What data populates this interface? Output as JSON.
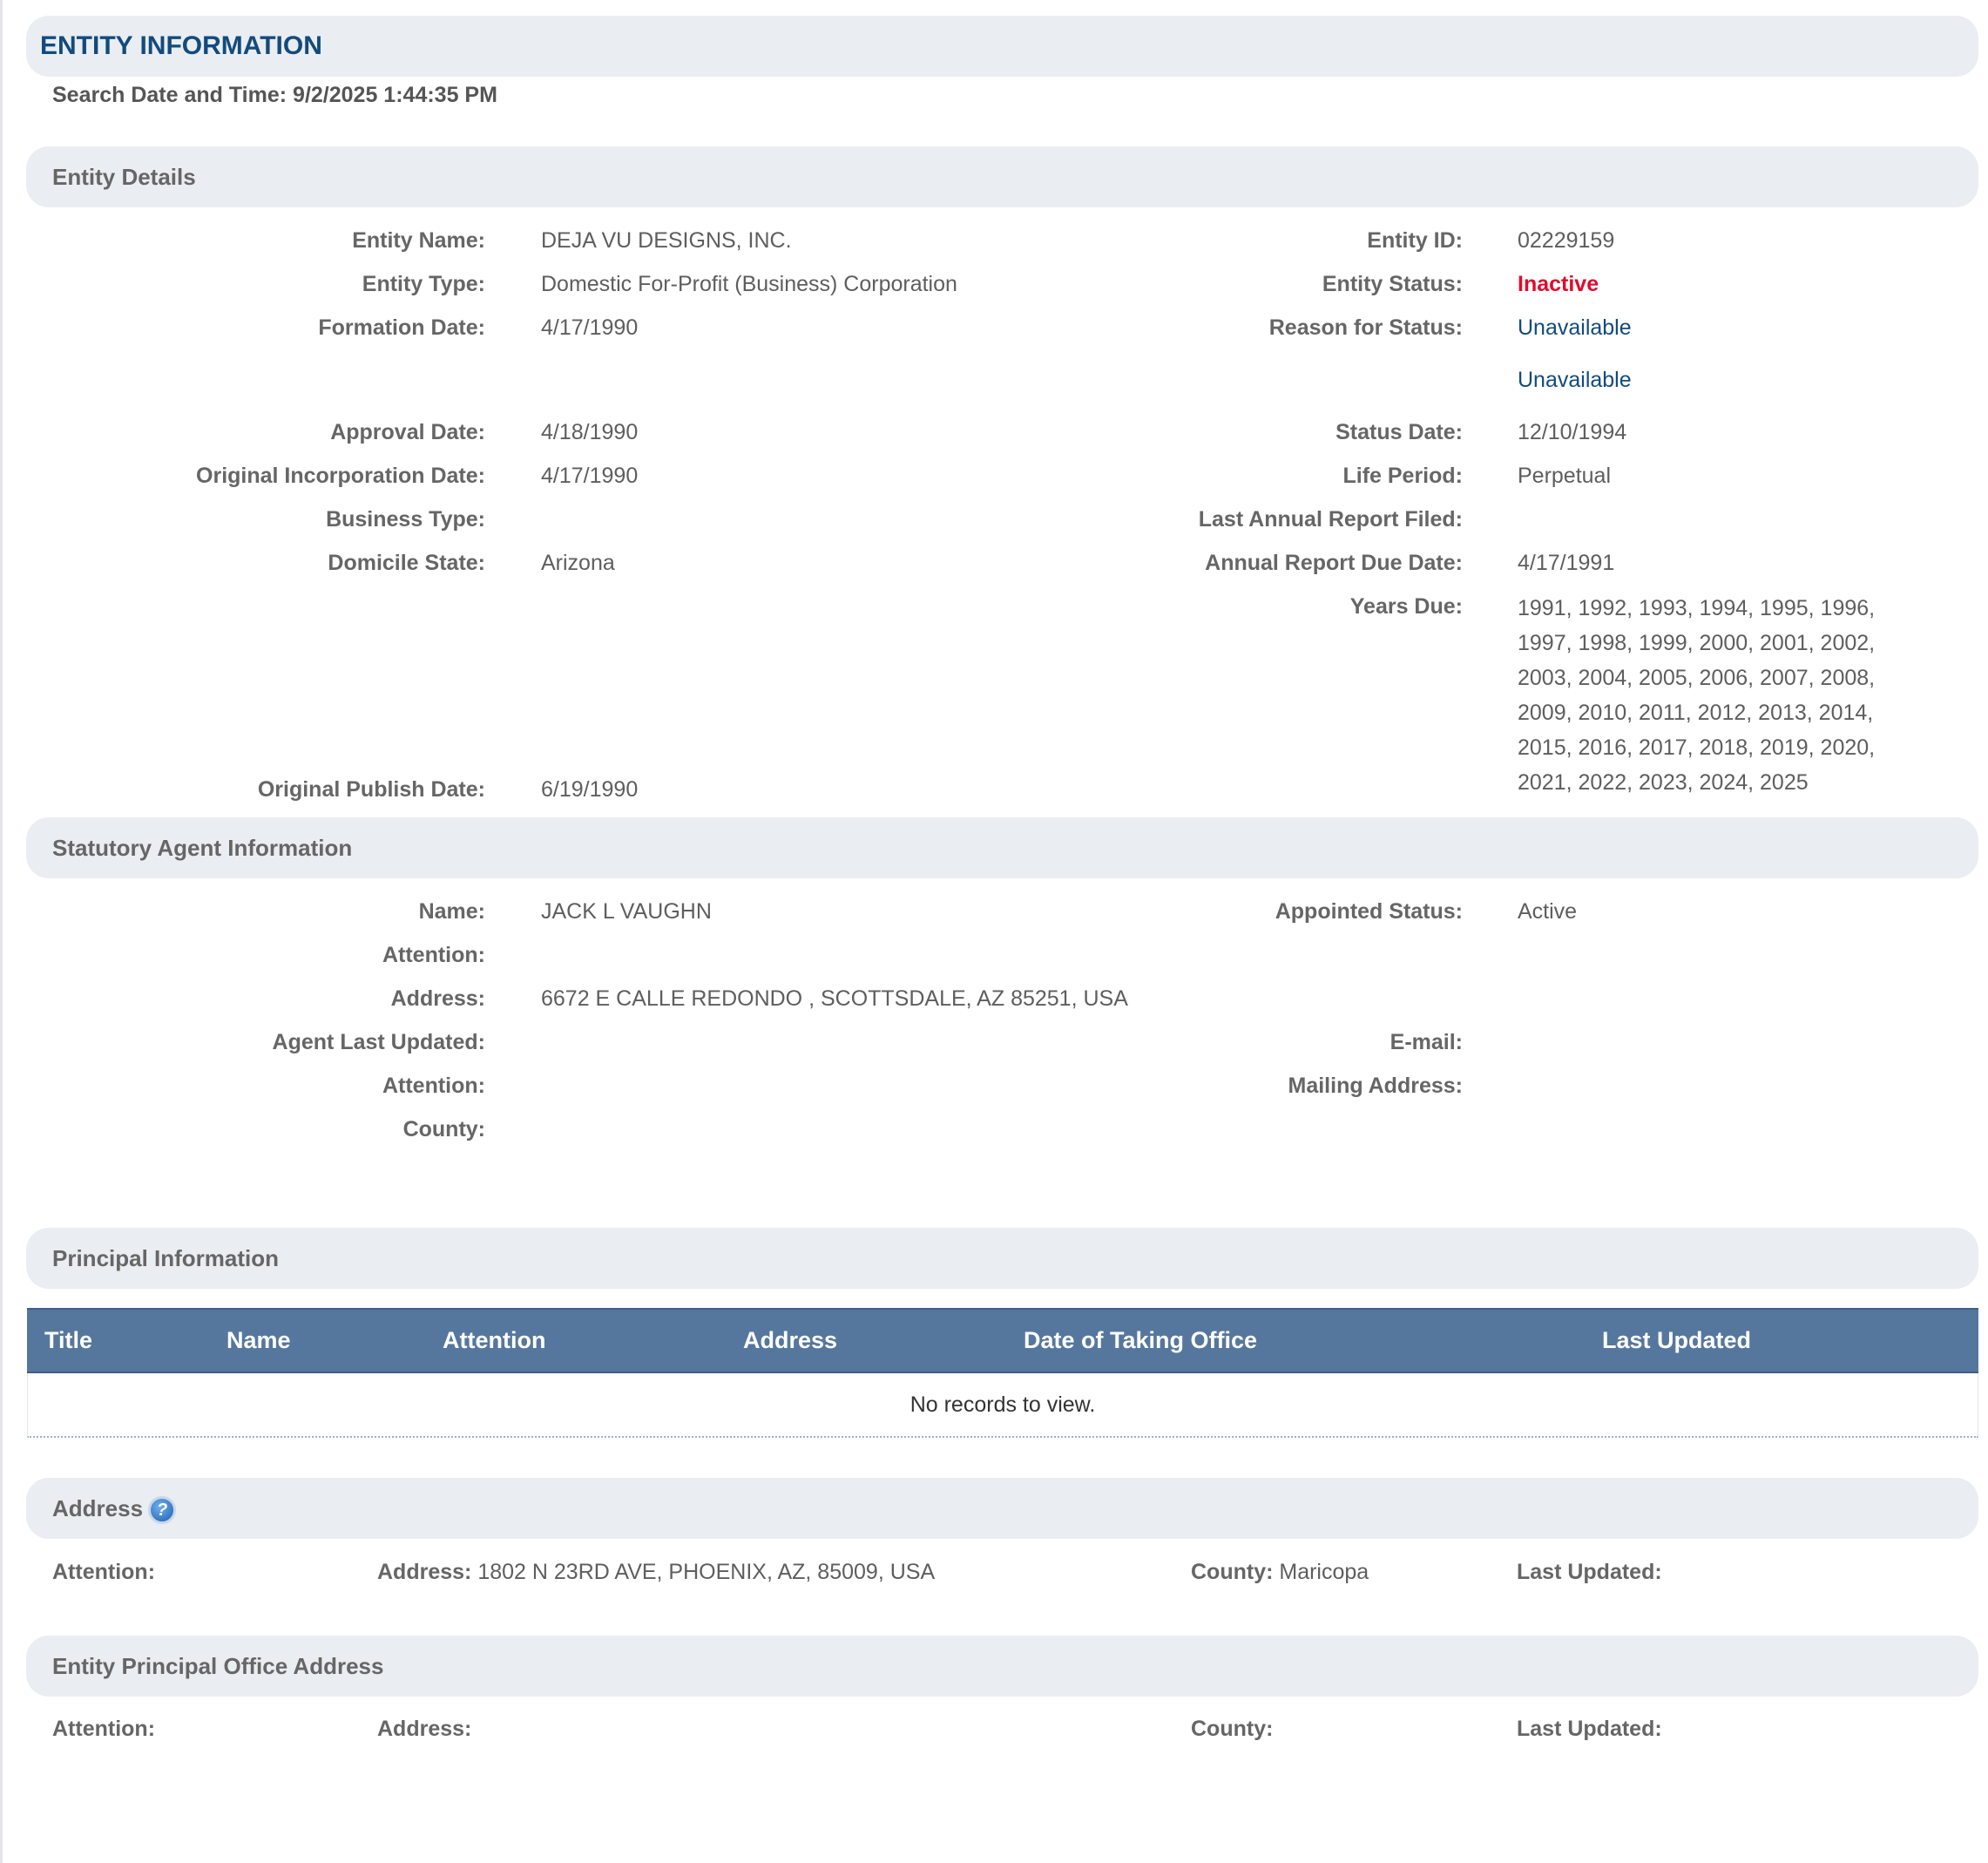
{
  "header": {
    "title": "ENTITY INFORMATION",
    "search_label": "Search Date and Time:",
    "search_value": "9/2/2025 1:44:35 PM"
  },
  "entity_details": {
    "section_title": "Entity Details",
    "entity_name_label": "Entity Name:",
    "entity_name": "DEJA VU DESIGNS, INC.",
    "entity_id_label": "Entity ID:",
    "entity_id": "02229159",
    "entity_type_label": "Entity Type:",
    "entity_type": "Domestic For-Profit (Business) Corporation",
    "entity_status_label": "Entity Status:",
    "entity_status": "Inactive",
    "formation_date_label": "Formation Date:",
    "formation_date": "4/17/1990",
    "reason_label": "Reason for Status:",
    "reason_1": "Unavailable",
    "reason_2": "Unavailable",
    "approval_date_label": "Approval Date:",
    "approval_date": "4/18/1990",
    "status_date_label": "Status Date:",
    "status_date": "12/10/1994",
    "orig_incorp_label": "Original Incorporation Date:",
    "orig_incorp_date": "4/17/1990",
    "life_period_label": "Life Period:",
    "life_period": "Perpetual",
    "business_type_label": "Business Type:",
    "business_type": "",
    "last_annual_label": "Last Annual Report Filed:",
    "last_annual": "",
    "domicile_label": "Domicile State:",
    "domicile_state": "Arizona",
    "annual_due_label": "Annual Report Due Date:",
    "annual_due_date": "4/17/1991",
    "years_due_label": "Years Due:",
    "years_due": "1991, 1992, 1993, 1994, 1995, 1996, 1997, 1998, 1999, 2000, 2001, 2002, 2003, 2004, 2005, 2006, 2007, 2008, 2009, 2010, 2011, 2012, 2013, 2014, 2015, 2016, 2017, 2018, 2019, 2020, 2021, 2022, 2023, 2024, 2025",
    "orig_publish_label": "Original Publish Date:",
    "orig_publish_date": "6/19/1990"
  },
  "agent": {
    "section_title": "Statutory Agent Information",
    "name_label": "Name:",
    "name": "JACK L VAUGHN",
    "appointed_label": "Appointed Status:",
    "appointed_status": "Active",
    "attention_label": "Attention:",
    "address_label": "Address:",
    "address": "6672 E CALLE REDONDO , SCOTTSDALE, AZ 85251, USA",
    "last_updated_label": "Agent Last Updated:",
    "email_label": "E-mail:",
    "attention2_label": "Attention:",
    "mailing_label": "Mailing Address:",
    "county_label": "County:"
  },
  "principal": {
    "section_title": "Principal Information",
    "columns": [
      "Title",
      "Name",
      "Attention",
      "Address",
      "Date of Taking Office",
      "Last Updated"
    ],
    "empty_message": "No records to view."
  },
  "address": {
    "section_title": "Address",
    "help_glyph": "?",
    "attention_label": "Attention:",
    "address_label": "Address:",
    "address_value": "1802 N 23RD AVE, PHOENIX, AZ, 85009, USA",
    "county_label": "County:",
    "county_value": "Maricopa",
    "last_updated_label": "Last Updated:"
  },
  "principal_office": {
    "section_title": "Entity Principal Office Address",
    "attention_label": "Attention:",
    "address_label": "Address:",
    "county_label": "County:",
    "last_updated_label": "Last Updated:"
  },
  "colors": {
    "title_blue": "#124b7d",
    "status_red": "#e00b2c",
    "bar_bg": "#eaedf1",
    "grid_header": "#56779d"
  }
}
